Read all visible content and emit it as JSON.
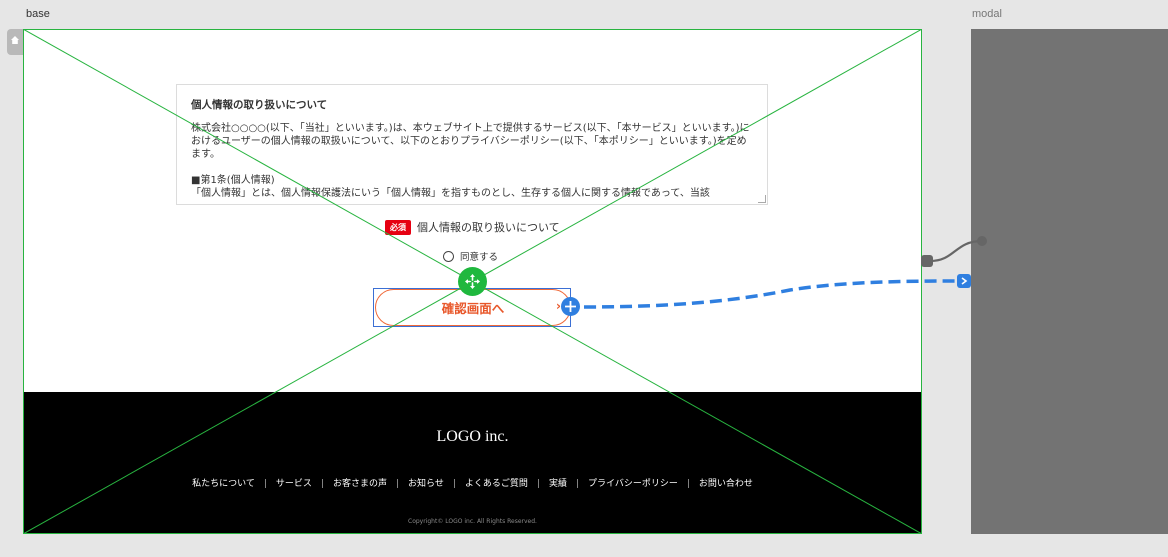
{
  "artboards": {
    "base_label": "base",
    "modal_label": "modal"
  },
  "policy": {
    "title": "個人情報の取り扱いについて",
    "paragraph1": "株式会社○○○○(以下、「当社」といいます。)は、本ウェブサイト上で提供するサービス(以下、「本サービス」といいます。)におけるユーザーの個人情報の取扱いについて、以下のとおりプライバシーポリシー(以下、「本ポリシー」といいます。)を定めます。",
    "section_heading": "■第1条(個人情報)",
    "section_text": "「個人情報」とは、個人情報保護法にいう「個人情報」を指すものとし、生存する個人に関する情報であって、当該"
  },
  "form": {
    "required_badge": "必須",
    "required_label": "個人情報の取り扱いについて",
    "agree_label": "同意する",
    "confirm_button": "確認画面へ",
    "confirm_chevron": "›"
  },
  "footer": {
    "logo": "LOGO inc.",
    "nav": [
      "私たちについて",
      "サービス",
      "お客さまの声",
      "お知らせ",
      "よくあるご質問",
      "実績",
      "プライバシーポリシー",
      "お問い合わせ"
    ],
    "separator": "|",
    "copyright": "Copyright© LOGO inc. All Rights Reserved."
  },
  "colors": {
    "selection_green": "#28b440",
    "link_blue": "#2f7fe0",
    "accent_orange": "#e8572a",
    "required_red": "#e60012"
  },
  "icons": {
    "home": "home-icon",
    "move": "move-icon",
    "add_link": "plus-icon",
    "link_target": "chevron-right-icon"
  }
}
